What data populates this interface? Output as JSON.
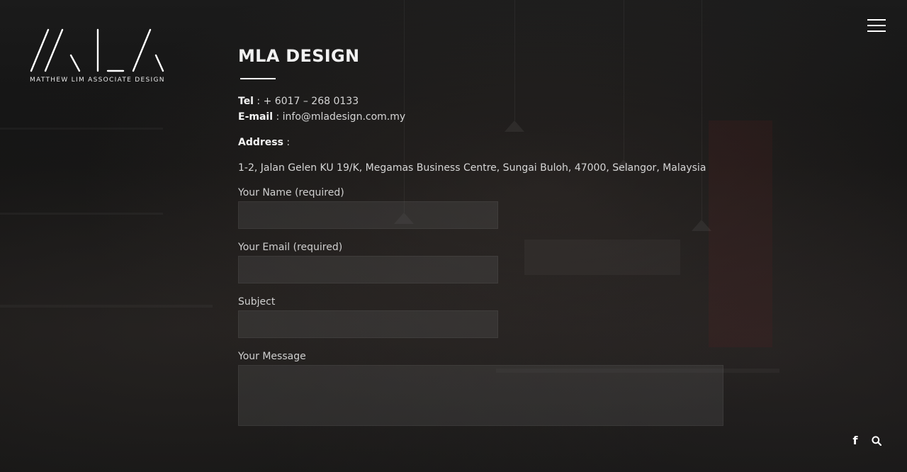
{
  "brand": {
    "tagline": "MATTHEW LIM ASSOCIATE DESIGN"
  },
  "header": {
    "menu_icon": "hamburger-icon"
  },
  "contact": {
    "title": "MLA DESIGN",
    "tel_label": "Tel",
    "tel_value": " : + 6017 – 268 0133",
    "email_label": "E-mail",
    "email_value": " : info@mladesign.com.my",
    "address_label": "Address",
    "address_sep": " :",
    "address_value": "1-2, Jalan Gelen KU 19/K, Megamas Business Centre, Sungai Buloh, 47000, Selangor, Malaysia"
  },
  "form": {
    "name_label": "Your Name (required)",
    "name_value": "",
    "email_label": "Your Email (required)",
    "email_value": "",
    "subject_label": "Subject",
    "subject_value": "",
    "message_label": "Your Message",
    "message_value": ""
  },
  "social": {
    "facebook_icon": "facebook-icon",
    "facebook_glyph": "f",
    "search_icon": "search-icon"
  }
}
